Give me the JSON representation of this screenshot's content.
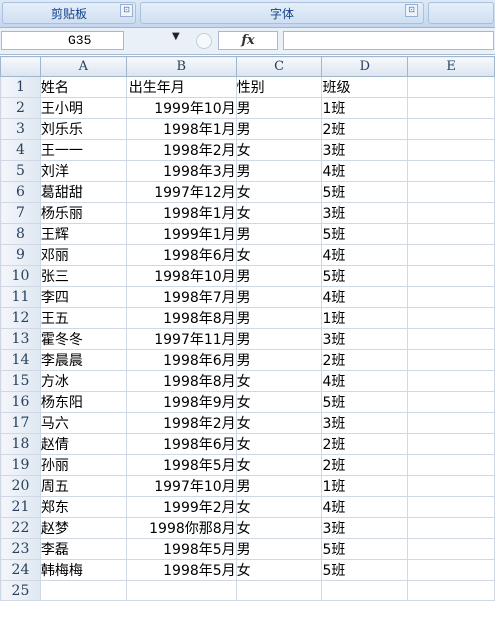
{
  "ribbon": {
    "clipboard_label": "剪贴板",
    "font_label": "字体",
    "launcher_glyph": "⊡"
  },
  "formula_bar": {
    "name_box": "G35",
    "dropdown_glyph": "▼",
    "fx_label": "fx",
    "formula": ""
  },
  "columns": [
    "A",
    "B",
    "C",
    "D",
    "E"
  ],
  "rows": [
    {
      "n": "1",
      "a": "姓名",
      "b": "出生年月",
      "c": "性别",
      "d": "班级",
      "b_left": true
    },
    {
      "n": "2",
      "a": "王小明",
      "b": "1999年10月",
      "c": "男",
      "d": "1班"
    },
    {
      "n": "3",
      "a": "刘乐乐",
      "b": "1998年1月",
      "c": "男",
      "d": "2班"
    },
    {
      "n": "4",
      "a": "王一一",
      "b": "1998年2月",
      "c": "女",
      "d": "3班"
    },
    {
      "n": "5",
      "a": "刘洋",
      "b": "1998年3月",
      "c": "男",
      "d": "4班"
    },
    {
      "n": "6",
      "a": "葛甜甜",
      "b": "1997年12月",
      "c": "女",
      "d": "5班"
    },
    {
      "n": "7",
      "a": "杨乐丽",
      "b": "1998年1月",
      "c": "女",
      "d": "3班"
    },
    {
      "n": "8",
      "a": "王辉",
      "b": "1999年1月",
      "c": "男",
      "d": "5班"
    },
    {
      "n": "9",
      "a": "邓丽",
      "b": "1998年6月",
      "c": "女",
      "d": "4班"
    },
    {
      "n": "10",
      "a": "张三",
      "b": "1998年10月",
      "c": "男",
      "d": "5班"
    },
    {
      "n": "11",
      "a": "李四",
      "b": "1998年7月",
      "c": "男",
      "d": "4班"
    },
    {
      "n": "12",
      "a": "王五",
      "b": "1998年8月",
      "c": "男",
      "d": "1班"
    },
    {
      "n": "13",
      "a": "霍冬冬",
      "b": "1997年11月",
      "c": "男",
      "d": "3班"
    },
    {
      "n": "14",
      "a": "李晨晨",
      "b": "1998年6月",
      "c": "男",
      "d": "2班"
    },
    {
      "n": "15",
      "a": "方冰",
      "b": "1998年8月",
      "c": "女",
      "d": "4班"
    },
    {
      "n": "16",
      "a": "杨东阳",
      "b": "1998年9月",
      "c": "女",
      "d": "5班"
    },
    {
      "n": "17",
      "a": "马六",
      "b": "1998年2月",
      "c": "女",
      "d": "3班"
    },
    {
      "n": "18",
      "a": "赵倩",
      "b": "1998年6月",
      "c": "女",
      "d": "2班"
    },
    {
      "n": "19",
      "a": "孙丽",
      "b": "1998年5月",
      "c": "女",
      "d": "2班"
    },
    {
      "n": "20",
      "a": "周五",
      "b": "1997年10月",
      "c": "男",
      "d": "1班"
    },
    {
      "n": "21",
      "a": "郑东",
      "b": "1999年2月",
      "c": "女",
      "d": "4班"
    },
    {
      "n": "22",
      "a": "赵梦",
      "b": "1998你那8月",
      "c": "女",
      "d": "3班"
    },
    {
      "n": "23",
      "a": "李磊",
      "b": "1998年5月",
      "c": "男",
      "d": "5班"
    },
    {
      "n": "24",
      "a": "韩梅梅",
      "b": "1998年5月",
      "c": "女",
      "d": "5班"
    },
    {
      "n": "25",
      "a": "",
      "b": "",
      "c": "",
      "d": ""
    }
  ],
  "colors": {
    "ribbon_text": "#15428b",
    "header_text": "#27415f",
    "gridline": "#d0d7e5"
  }
}
